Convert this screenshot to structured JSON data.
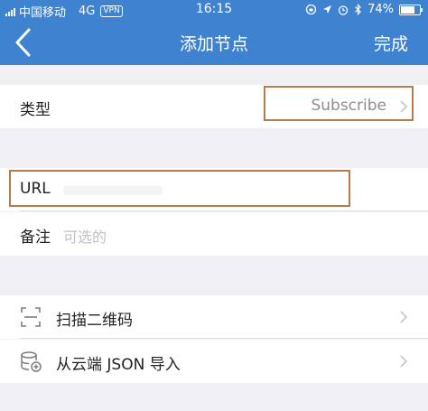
{
  "status_bar": {
    "carrier": "中国移动",
    "network": "4G",
    "vpn": "VPN",
    "time": "16:15",
    "battery_percent": "74%",
    "battery_level": 0.74,
    "icons": [
      "signal-icon",
      "rotation-lock-icon",
      "location-icon",
      "alarm-icon",
      "bluetooth-icon",
      "battery-icon"
    ]
  },
  "nav": {
    "title": "添加节点",
    "done_label": "完成",
    "back_icon": "chevron-left-icon"
  },
  "form": {
    "type_label": "类型",
    "type_value": "Subscribe",
    "url_label": "URL",
    "note_label": "备注",
    "note_placeholder": "可选的"
  },
  "actions": {
    "scan_label": "扫描二维码",
    "import_label": "从云端 JSON 导入"
  },
  "colors": {
    "nav_background": "#3f82cf",
    "highlight": "#b57a4d",
    "page_background": "#efeff4"
  }
}
